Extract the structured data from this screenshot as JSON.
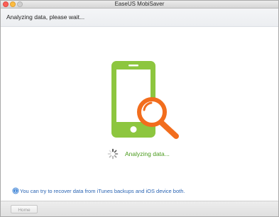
{
  "window": {
    "title": "EaseUS MobiSaver"
  },
  "header": {
    "status": "Analyzing data, please wait..."
  },
  "main": {
    "illustration_icon": "phone-with-magnifier-icon",
    "spinner_icon": "loading-spinner-icon",
    "progress_text": "Analyzing data..."
  },
  "tip": {
    "icon": "info-icon",
    "text": "You can try to recover data from iTunes backups and iOS device both."
  },
  "footer": {
    "home_label": "Home"
  },
  "colors": {
    "phone_green": "#8dc63f",
    "magnifier_orange": "#f26d1d",
    "progress_green": "#4a9a1c",
    "tip_blue": "#2a64b3"
  }
}
